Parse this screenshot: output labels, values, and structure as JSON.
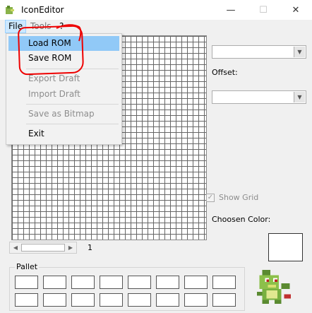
{
  "window": {
    "title": "IconEditor",
    "minimize": "—",
    "maximize": "☐",
    "close": "✕"
  },
  "menubar": {
    "file": "File",
    "tools": "Tools",
    "help": "?"
  },
  "file_menu": {
    "load_rom": "Load ROM",
    "save_rom": "Save ROM",
    "export_draft": "Export Draft",
    "import_draft": "Import Draft",
    "save_as_bitmap": "Save as Bitmap",
    "exit": "Exit"
  },
  "right_panel": {
    "offset_label": "Offset:",
    "show_grid_label": "Show Grid",
    "show_grid_checked": true,
    "chosen_color_label": "Choosen Color:",
    "chosen_color": "#ffffff"
  },
  "scroll": {
    "value": "1"
  },
  "pallet": {
    "label": "Pallet",
    "swatch_count": 16
  },
  "colors": {
    "annotation": "#e00000",
    "menu_highlight": "#91c9f7"
  }
}
